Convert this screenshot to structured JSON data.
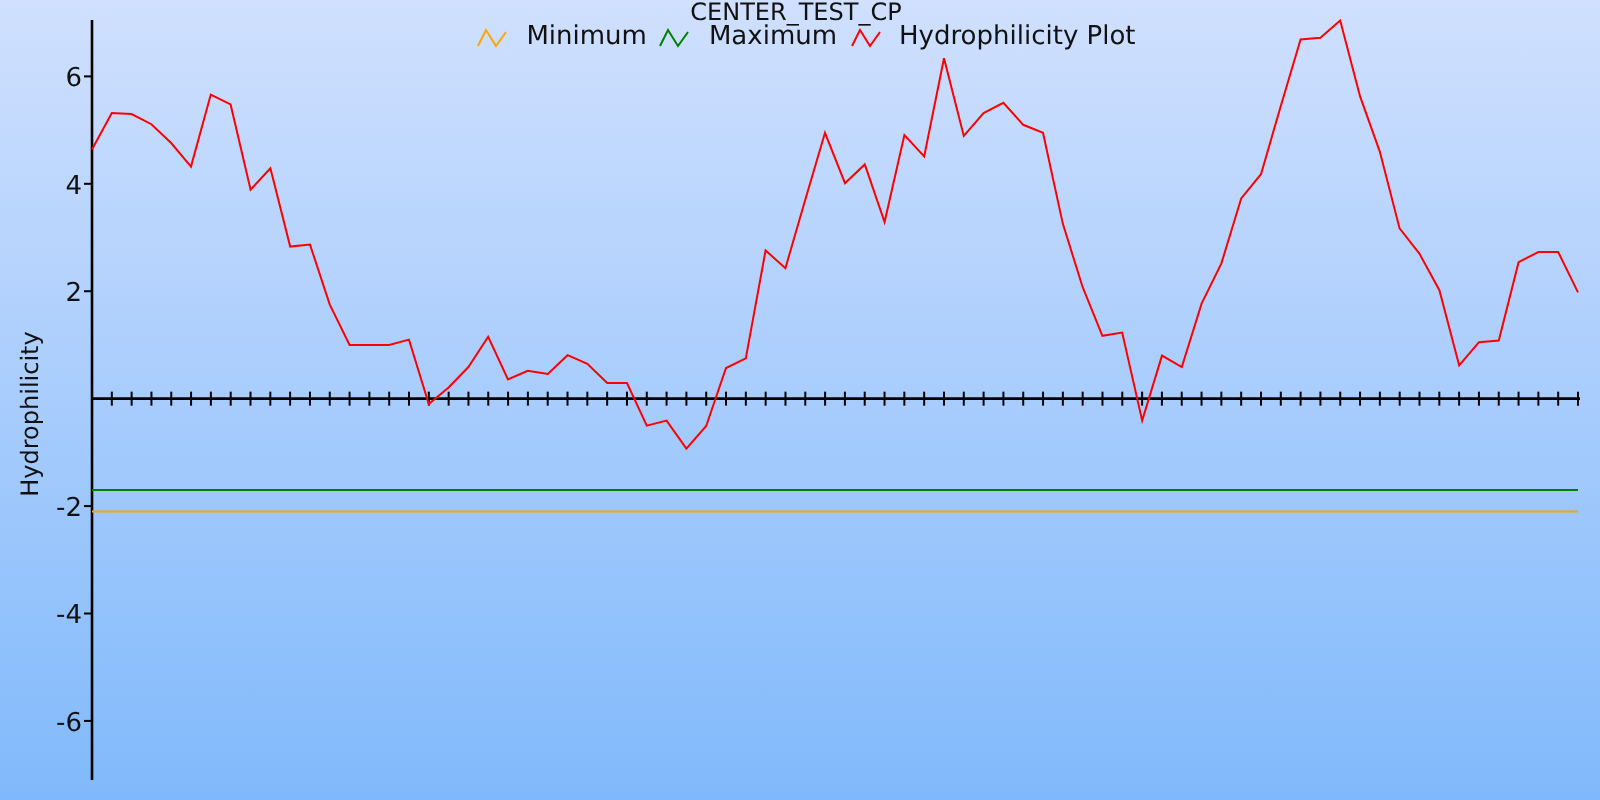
{
  "chart_data": {
    "type": "line",
    "title": "CENTER_TEST_CP",
    "ylabel": "Hydrophilicity",
    "ylim": [
      -7.1,
      7.05
    ],
    "yticks": [
      6,
      4,
      2,
      -2,
      -4,
      -6
    ],
    "series": [
      {
        "name": "Minimum",
        "color": "#ffa500",
        "values": [
          -2.1,
          -2.1,
          -2.1,
          -2.1,
          -2.1,
          -2.1,
          -2.1,
          -2.1,
          -2.1,
          -2.1,
          -2.1,
          -2.1,
          -2.1,
          -2.1,
          -2.1,
          -2.1,
          -2.1,
          -2.1,
          -2.1,
          -2.1,
          -2.1,
          -2.1,
          -2.1,
          -2.1,
          -2.1,
          -2.1,
          -2.1,
          -2.1,
          -2.1,
          -2.1,
          -2.1,
          -2.1,
          -2.1,
          -2.1,
          -2.1,
          -2.1,
          -2.1,
          -2.1,
          -2.1,
          -2.1,
          -2.1,
          -2.1,
          -2.1,
          -2.1,
          -2.1,
          -2.1,
          -2.1,
          -2.1,
          -2.1,
          -2.1,
          -2.1,
          -2.1,
          -2.1,
          -2.1,
          -2.1,
          -2.1,
          -2.1,
          -2.1,
          -2.1,
          -2.1,
          -2.1,
          -2.1,
          -2.1,
          -2.1,
          -2.1,
          -2.1,
          -2.1,
          -2.1,
          -2.1,
          -2.1,
          -2.1,
          -2.1,
          -2.1,
          -2.1,
          -2.1,
          -2.1
        ]
      },
      {
        "name": "Maximum",
        "color": "#008000",
        "values": [
          -1.7,
          -1.7,
          -1.7,
          -1.7,
          -1.7,
          -1.7,
          -1.7,
          -1.7,
          -1.7,
          -1.7,
          -1.7,
          -1.7,
          -1.7,
          -1.7,
          -1.7,
          -1.7,
          -1.7,
          -1.7,
          -1.7,
          -1.7,
          -1.7,
          -1.7,
          -1.7,
          -1.7,
          -1.7,
          -1.7,
          -1.7,
          -1.7,
          -1.7,
          -1.7,
          -1.7,
          -1.7,
          -1.7,
          -1.7,
          -1.7,
          -1.7,
          -1.7,
          -1.7,
          -1.7,
          -1.7,
          -1.7,
          -1.7,
          -1.7,
          -1.7,
          -1.7,
          -1.7,
          -1.7,
          -1.7,
          -1.7,
          -1.7,
          -1.7,
          -1.7,
          -1.7,
          -1.7,
          -1.7,
          -1.7,
          -1.7,
          -1.7,
          -1.7,
          -1.7,
          -1.7,
          -1.7,
          -1.7,
          -1.7,
          -1.7,
          -1.7,
          -1.7,
          -1.7,
          -1.7,
          -1.7,
          -1.7,
          -1.7,
          -1.7,
          -1.7,
          -1.7,
          -1.7
        ]
      },
      {
        "name": "Hydrophilicity Plot",
        "color": "#ff0000",
        "values": [
          4.64,
          5.32,
          5.3,
          5.11,
          4.76,
          4.32,
          5.66,
          5.48,
          3.89,
          4.29,
          2.83,
          2.87,
          1.75,
          1.0,
          1.0,
          1.0,
          1.1,
          -0.1,
          0.21,
          0.59,
          1.15,
          0.36,
          0.52,
          0.46,
          0.81,
          0.65,
          0.29,
          0.29,
          -0.5,
          -0.41,
          -0.93,
          -0.51,
          0.57,
          0.75,
          2.76,
          2.43,
          3.7,
          4.95,
          4.01,
          4.36,
          3.29,
          4.91,
          4.51,
          6.34,
          4.89,
          5.32,
          5.51,
          5.1,
          4.95,
          3.26,
          2.08,
          1.17,
          1.23,
          -0.41,
          0.8,
          0.59,
          1.77,
          2.52,
          3.73,
          4.18,
          5.45,
          6.69,
          6.72,
          7.04,
          5.63,
          4.6,
          3.17,
          2.7,
          2.02,
          0.62,
          1.05,
          1.08,
          2.54,
          2.73,
          2.73,
          1.98
        ]
      }
    ]
  }
}
